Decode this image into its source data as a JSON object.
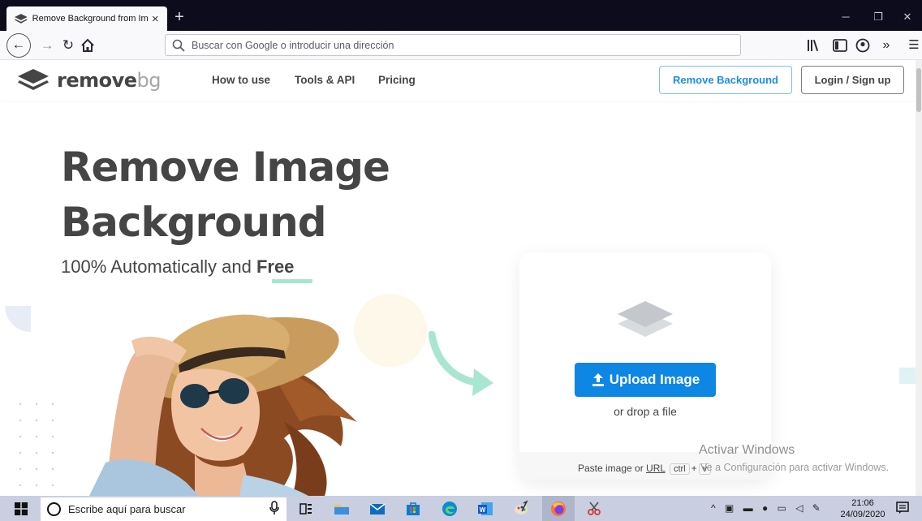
{
  "browser": {
    "tab_title": "Remove Background from Imag",
    "new_tab": "+",
    "url_placeholder": "Buscar con Google o introducir una dirección",
    "win_minimize": "─",
    "win_restore": "❐",
    "win_close": "✕"
  },
  "site": {
    "logo_word_1": "remove",
    "logo_word_2": "bg",
    "nav": [
      "How to use",
      "Tools & API",
      "Pricing"
    ],
    "cta_remove": "Remove Background",
    "cta_login": "Login / Sign up"
  },
  "hero": {
    "title_line_1": "Remove Image",
    "title_line_2": "Background",
    "subtitle_prefix": "100% Automatically and ",
    "subtitle_emphasis": "Free"
  },
  "upload": {
    "button_label": "Upload Image",
    "drop_text": "or drop a file",
    "paste_prefix": "Paste image or ",
    "paste_url": "URL",
    "kbd_ctrl": "ctrl",
    "kbd_plus": "+",
    "kbd_v": "v"
  },
  "watermark": {
    "line_1": "Activar Windows",
    "line_2": "Ve a Configuración para activar Windows."
  },
  "taskbar": {
    "search_placeholder": "Escribe aquí para buscar",
    "time": "21:06",
    "date": "24/09/2020"
  },
  "colors": {
    "brand_blue": "#0e86e4",
    "heading_gray": "#454545",
    "accent_mint": "#a9e6cf"
  }
}
